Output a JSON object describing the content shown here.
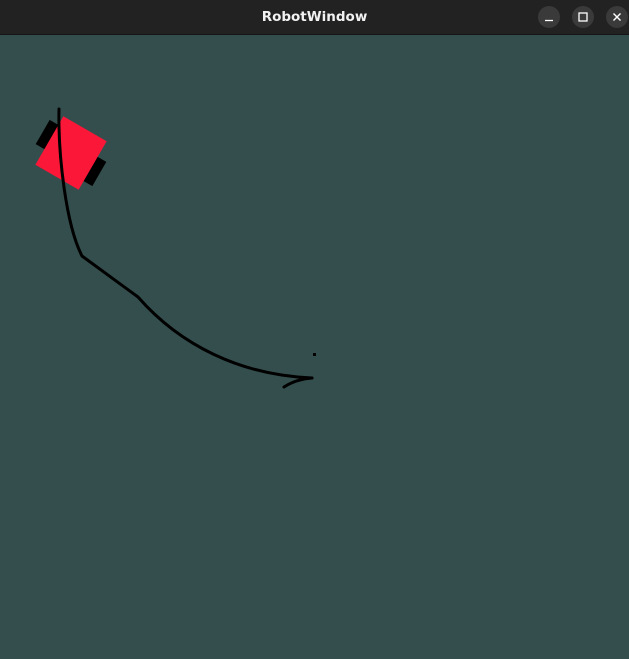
{
  "window": {
    "title": "RobotWindow"
  },
  "controls": {
    "minimize_icon": "minimize-icon",
    "maximize_icon": "maximize-icon",
    "close_icon": "close-icon"
  },
  "colors": {
    "background": "#344e4d",
    "titlebar": "#222222",
    "robot_body": "#fb1738",
    "robot_wheels": "#000000",
    "path": "#000000"
  }
}
